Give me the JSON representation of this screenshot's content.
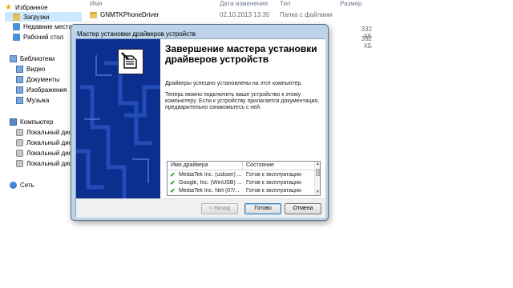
{
  "nav": {
    "favorites": "Избранное",
    "downloads": "Загрузки",
    "recent": "Недавние места",
    "desktop": "Рабочий стол",
    "libraries": "Библиотеки",
    "video": "Видео",
    "documents": "Документы",
    "images": "Изображения",
    "music": "Музыка",
    "computer": "Компьютер",
    "disks": [
      "Локальный диск",
      "Локальный диск",
      "Локальный диск",
      "Локальный диск"
    ],
    "network": "Сеть"
  },
  "columns": {
    "name": "Имя",
    "date": "Дата изменения",
    "type": "Тип",
    "size": "Размер"
  },
  "files": [
    {
      "name": "GNMTKPhoneDriver",
      "date": "02.10.2013 13:35",
      "type": "Папка с файлами",
      "size": ""
    }
  ],
  "sizes": [
    "332 КБ",
    "332 КБ"
  ],
  "dialog": {
    "title": "Мастер установки драйверов устройств",
    "heading": "Завершение мастера установки драйверов устройств",
    "message1": "Драйверы успешно установлены на этот компьютер.",
    "message2": "Теперь можно подключить ваше устройство к этому компьютеру. Если к устройству прилагается документация, предварительно ознакомьтесь с ней.",
    "grid_headers": {
      "name": "Имя драйвера",
      "status": "Состояние"
    },
    "drivers": [
      {
        "name": "MediaTek Inc. (usbser) ...",
        "status": "Готов к эксплуатации"
      },
      {
        "name": "Google, Inc. (WinUSB) ...",
        "status": "Готов к эксплуатации"
      },
      {
        "name": "MediaTek Inc. Net  (07/...",
        "status": "Готов к эксплуатации"
      }
    ],
    "buttons": {
      "back": "< Назад",
      "finish": "Готово",
      "cancel": "Отмена"
    }
  }
}
